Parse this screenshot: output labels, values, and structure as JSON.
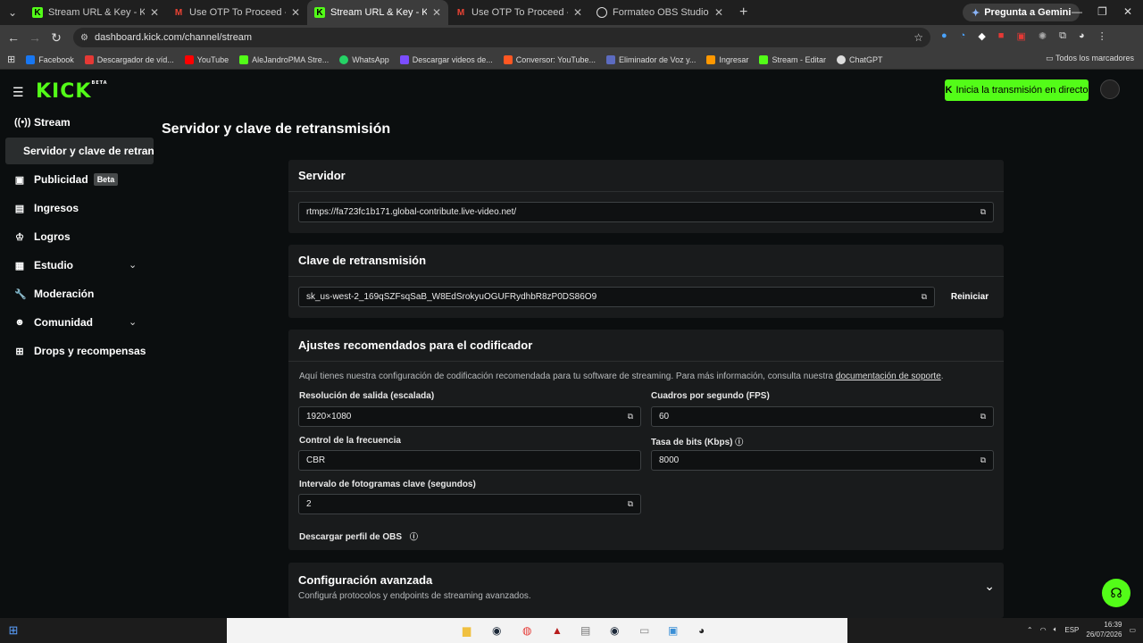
{
  "browser": {
    "tabs": [
      {
        "title": "Stream URL & Key - Kick Dashb",
        "icon": "kick"
      },
      {
        "title": "Use OTP To Proceed - aalejand",
        "icon": "gmail"
      },
      {
        "title": "Stream URL & Key - Kick Dashb",
        "icon": "kick",
        "active": true
      },
      {
        "title": "Use OTP To Proceed - aalejand",
        "icon": "gmail"
      },
      {
        "title": "Formateo OBS Studio",
        "icon": "obs"
      }
    ],
    "gemini_label": "Pregunta a Gemini",
    "url": "dashboard.kick.com/channel/stream",
    "bookmarks": [
      {
        "label": "Facebook",
        "color": "#1877f2"
      },
      {
        "label": "Descargador de víd...",
        "color": "#e53935"
      },
      {
        "label": "YouTube",
        "color": "#ff0000"
      },
      {
        "label": "AleJandroPMA Stre...",
        "color": "#53fc18"
      },
      {
        "label": "WhatsApp",
        "color": "#25d366"
      },
      {
        "label": "Descargar videos de...",
        "color": "#7b4dff"
      },
      {
        "label": "Conversor: YouTube...",
        "color": "#ff5722"
      },
      {
        "label": "Eliminador de Voz y...",
        "color": "#5c6bc0"
      },
      {
        "label": "Ingresar",
        "color": "#ff9800"
      },
      {
        "label": "Stream - Editar",
        "color": "#53fc18"
      },
      {
        "label": "ChatGPT",
        "color": "#dddddd"
      }
    ],
    "all_bookmarks": "Todos los marcadores"
  },
  "header": {
    "logo": "KICK",
    "logo_sup": "BETA",
    "golive_label": "Inicia la transmisión en directo",
    "accent": "#53fc18"
  },
  "sidebar": {
    "items": [
      {
        "label": "Stream",
        "icon": "broadcast-icon"
      },
      {
        "label": "Servidor y clave de retransmisión",
        "sub": true
      },
      {
        "label": "Publicidad",
        "badge": "Beta",
        "icon": "ad-icon"
      },
      {
        "label": "Ingresos",
        "icon": "chart-icon"
      },
      {
        "label": "Logros",
        "icon": "trophy-icon"
      },
      {
        "label": "Estudio",
        "icon": "studio-icon",
        "expandable": true
      },
      {
        "label": "Moderación",
        "icon": "wrench-icon"
      },
      {
        "label": "Comunidad",
        "icon": "people-icon",
        "expandable": true
      },
      {
        "label": "Drops y recompensas",
        "icon": "gift-icon"
      }
    ]
  },
  "main": {
    "title": "Servidor y clave de retransmisión",
    "server": {
      "heading": "Servidor",
      "value": "rtmps://fa723fc1b171.global-contribute.live-video.net/"
    },
    "key": {
      "heading": "Clave de retransmisión",
      "value": "sk_us-west-2_169qSZFsqSaB_W8EdSrokyuOGUFRydhbR8zP0DS86O9",
      "reset_label": "Reiniciar"
    },
    "encoder": {
      "heading": "Ajustes recomendados para el codificador",
      "description": "Aquí tienes nuestra configuración de codificación recomendada para tu software de streaming. Para más información, consulta nuestra",
      "doc_link": "documentación de soporte",
      "resolution_label": "Resolución de salida (escalada)",
      "resolution_value": "1920×1080",
      "fps_label": "Cuadros por segundo (FPS)",
      "fps_value": "60",
      "rate_control_label": "Control de la frecuencia",
      "rate_control_value": "CBR",
      "bitrate_label": "Tasa de bits (Kbps)",
      "bitrate_value": "8000",
      "keyframe_label": "Intervalo de fotogramas clave (segundos)",
      "keyframe_value": "2",
      "download_label": "Descargar perfil de OBS"
    },
    "advanced": {
      "heading": "Configuración avanzada",
      "description": "Configurá protocolos y endpoints de streaming avanzados."
    }
  },
  "taskbar": {
    "language": "ESP",
    "time": "16:39",
    "date": "26/07/2026"
  }
}
